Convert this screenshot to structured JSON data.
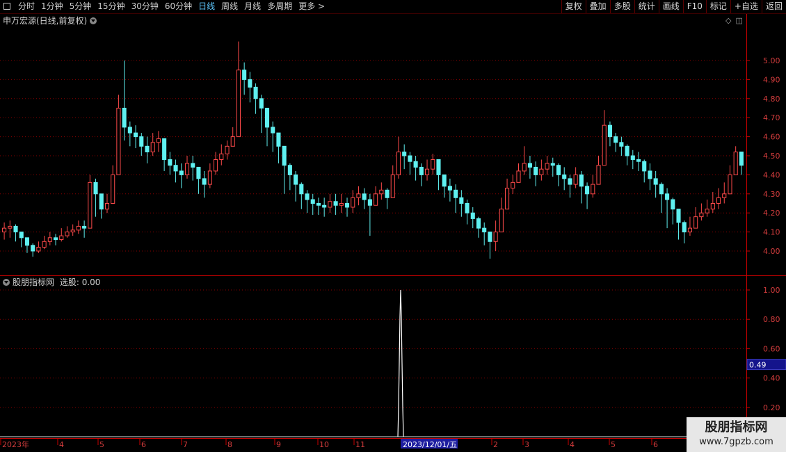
{
  "toolbar": {
    "period_tabs": [
      "分时",
      "1分钟",
      "5分钟",
      "15分钟",
      "30分钟",
      "60分钟",
      "日线",
      "周线",
      "月线",
      "多周期",
      "更多 >"
    ],
    "active_tab": "日线",
    "right_tools": [
      "复权",
      "叠加",
      "多股",
      "统计",
      "画线",
      "F10",
      "标记",
      "+自选",
      "返回"
    ]
  },
  "main_pane": {
    "title": "申万宏源(日线,前复权)",
    "y_ticks": [
      "5.00",
      "4.90",
      "4.80",
      "4.70",
      "4.60",
      "4.50",
      "4.40",
      "4.30",
      "4.20",
      "4.10",
      "4.00"
    ]
  },
  "indicator_pane": {
    "title": "股朋指标网",
    "label": "选股: 0.00",
    "y_ticks": [
      "1.00",
      "0.80",
      "0.60",
      "0.40",
      "0.20"
    ],
    "current_value": "0.49"
  },
  "x_axis": {
    "labels": [
      "2023年",
      "4",
      "5",
      "6",
      "7",
      "8",
      "9",
      "10",
      "11",
      "2023/12/01/五",
      "2",
      "3",
      "4",
      "5",
      "6"
    ]
  },
  "watermark": {
    "title": "股朋指标网",
    "url": "www.7gpzb.com"
  },
  "colors": {
    "up": "#ff4a4a",
    "down": "#5ff0f0",
    "grid": "#8a0000",
    "axis": "#c80000",
    "value_box": "#14148c",
    "text": "#c8c8c8"
  },
  "chart_data": [
    {
      "type": "candlestick",
      "title": "申万宏源(日线,前复权)",
      "ylim": [
        3.95,
        5.12
      ],
      "x": [
        "2023年",
        "4",
        "5",
        "6",
        "7",
        "8",
        "9",
        "10",
        "11",
        "2023/12/01/五",
        "2",
        "3",
        "4",
        "5",
        "6"
      ],
      "close": [
        4.12,
        4.13,
        4.1,
        4.07,
        4.03,
        4.0,
        4.02,
        4.05,
        4.07,
        4.06,
        4.08,
        4.1,
        4.11,
        4.13,
        4.12,
        4.36,
        4.3,
        4.22,
        4.25,
        4.4,
        4.75,
        4.65,
        4.62,
        4.6,
        4.55,
        4.52,
        4.57,
        4.59,
        4.48,
        4.45,
        4.42,
        4.4,
        4.46,
        4.44,
        4.38,
        4.35,
        4.42,
        4.48,
        4.51,
        4.55,
        4.6,
        4.95,
        4.9,
        4.86,
        4.8,
        4.75,
        4.65,
        4.62,
        4.55,
        4.45,
        4.4,
        4.35,
        4.3,
        4.27,
        4.25,
        4.24,
        4.23,
        4.26,
        4.24,
        4.25,
        4.23,
        4.28,
        4.3,
        4.27,
        4.24,
        4.3,
        4.32,
        4.28,
        4.4,
        4.52,
        4.5,
        4.47,
        4.44,
        4.4,
        4.43,
        4.48,
        4.4,
        4.34,
        4.32,
        4.28,
        4.25,
        4.2,
        4.17,
        4.12,
        4.1,
        4.05,
        4.1,
        4.22,
        4.33,
        4.36,
        4.42,
        4.46,
        4.44,
        4.4,
        4.43,
        4.46,
        4.45,
        4.4,
        4.38,
        4.35,
        4.4,
        4.34,
        4.3,
        4.35,
        4.45,
        4.66,
        4.6,
        4.57,
        4.55,
        4.5,
        4.48,
        4.47,
        4.42,
        4.38,
        4.35,
        4.3,
        4.27,
        4.22,
        4.15,
        4.1,
        4.12,
        4.18,
        4.2,
        4.22,
        4.25,
        4.28,
        4.3,
        4.4,
        4.52,
        4.45
      ],
      "high": [
        4.15,
        4.16,
        4.14,
        4.1,
        4.06,
        4.04,
        4.05,
        4.08,
        4.1,
        4.09,
        4.12,
        4.13,
        4.14,
        4.16,
        4.16,
        4.4,
        4.38,
        4.28,
        4.3,
        4.45,
        4.82,
        5.0,
        4.68,
        4.66,
        4.62,
        4.6,
        4.62,
        4.63,
        4.55,
        4.52,
        4.48,
        4.46,
        4.5,
        4.5,
        4.44,
        4.42,
        4.46,
        4.52,
        4.56,
        4.58,
        4.65,
        5.1,
        4.99,
        4.94,
        4.88,
        4.82,
        4.72,
        4.68,
        4.6,
        4.52,
        4.46,
        4.42,
        4.36,
        4.32,
        4.3,
        4.28,
        4.28,
        4.3,
        4.3,
        4.3,
        4.28,
        4.32,
        4.34,
        4.33,
        4.3,
        4.34,
        4.36,
        4.33,
        4.45,
        4.6,
        4.56,
        4.52,
        4.5,
        4.46,
        4.48,
        4.51,
        4.48,
        4.4,
        4.38,
        4.35,
        4.32,
        4.27,
        4.23,
        4.18,
        4.15,
        4.1,
        4.16,
        4.28,
        4.38,
        4.4,
        4.46,
        4.55,
        4.5,
        4.47,
        4.48,
        4.5,
        4.49,
        4.46,
        4.44,
        4.4,
        4.44,
        4.42,
        4.36,
        4.4,
        4.5,
        4.74,
        4.68,
        4.62,
        4.6,
        4.56,
        4.53,
        4.52,
        4.48,
        4.46,
        4.42,
        4.36,
        4.33,
        4.28,
        4.22,
        4.16,
        4.18,
        4.23,
        4.25,
        4.27,
        4.31,
        4.33,
        4.36,
        4.45,
        4.55,
        4.5
      ],
      "low": [
        4.06,
        4.07,
        4.05,
        4.02,
        3.99,
        3.97,
        3.99,
        4.01,
        4.03,
        4.03,
        4.05,
        4.07,
        4.08,
        4.09,
        4.07,
        4.2,
        4.18,
        4.17,
        4.2,
        4.25,
        4.55,
        4.58,
        4.55,
        4.54,
        4.5,
        4.46,
        4.5,
        4.52,
        4.42,
        4.4,
        4.36,
        4.33,
        4.38,
        4.37,
        4.3,
        4.28,
        4.33,
        4.4,
        4.45,
        4.48,
        4.55,
        4.8,
        4.82,
        4.78,
        4.72,
        4.62,
        4.55,
        4.52,
        4.46,
        4.3,
        4.32,
        4.26,
        4.22,
        4.2,
        4.19,
        4.19,
        4.18,
        4.2,
        4.19,
        4.2,
        4.18,
        4.2,
        4.24,
        4.22,
        4.08,
        4.24,
        4.27,
        4.22,
        4.3,
        4.38,
        4.43,
        4.4,
        4.37,
        4.34,
        4.37,
        4.4,
        4.32,
        4.28,
        4.26,
        4.2,
        4.18,
        4.14,
        4.12,
        4.07,
        4.03,
        3.96,
        4.0,
        4.1,
        4.25,
        4.3,
        4.36,
        4.4,
        4.38,
        4.34,
        4.37,
        4.4,
        4.39,
        4.34,
        4.32,
        4.28,
        4.33,
        4.25,
        4.22,
        4.28,
        4.38,
        4.5,
        4.55,
        4.52,
        4.5,
        4.45,
        4.43,
        4.42,
        4.36,
        4.32,
        4.28,
        4.2,
        4.12,
        4.14,
        4.06,
        4.04,
        4.08,
        4.14,
        4.16,
        4.18,
        4.2,
        4.22,
        4.25,
        4.35,
        4.47,
        4.4
      ]
    },
    {
      "type": "line",
      "title": "股朋指标网",
      "series": [
        {
          "name": "选股",
          "values": [
            [
              0,
              0.0
            ],
            [
              95,
              0.0
            ],
            [
              96,
              0.2
            ],
            [
              97,
              0.5
            ],
            [
              98,
              0.82
            ],
            [
              99,
              1.0
            ],
            [
              100,
              0.0
            ],
            [
              132,
              0.0
            ]
          ]
        }
      ],
      "ylim": [
        0.0,
        1.05
      ],
      "current_value": 0.49
    }
  ]
}
